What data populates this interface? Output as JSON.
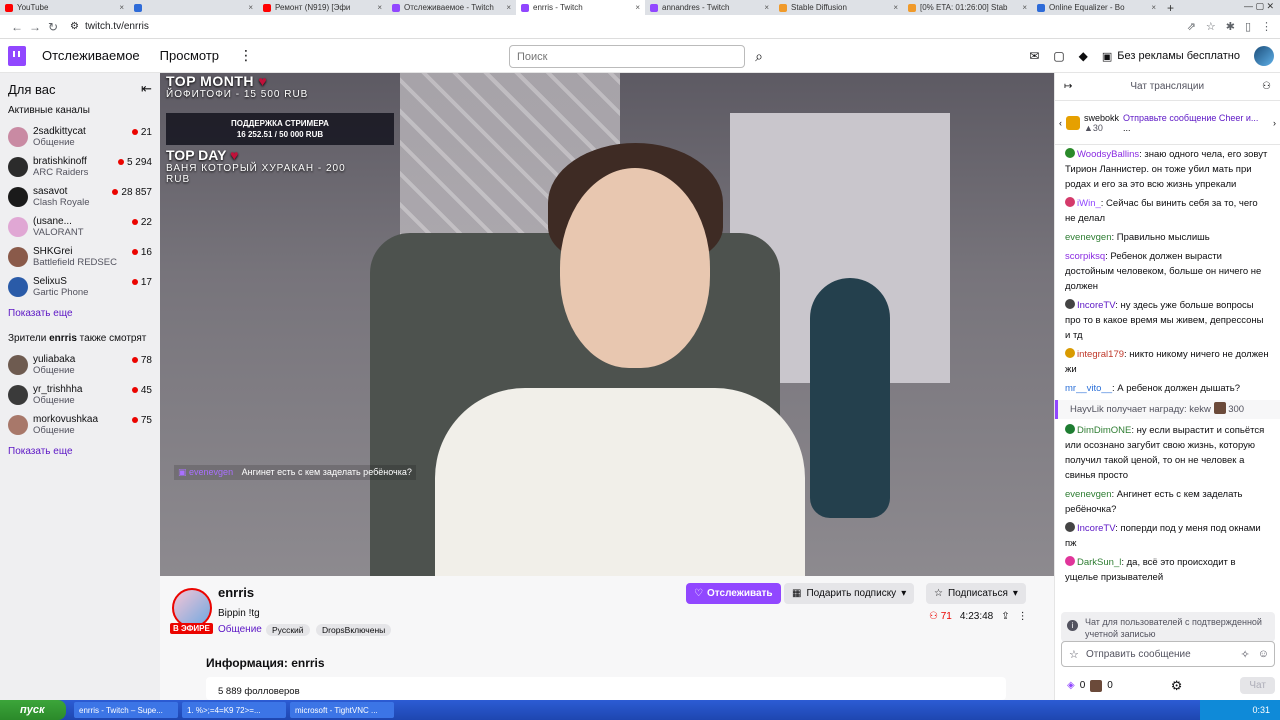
{
  "browser": {
    "tabs": [
      {
        "label": "YouTube",
        "color": "#ff0000"
      },
      {
        "label": "",
        "color": "#2e6bd8"
      },
      {
        "label": "Ремонт (N919) [Эфи",
        "color": "#ff0000"
      },
      {
        "label": "Отслеживаемое - Twitch",
        "color": "#9147ff"
      },
      {
        "label": "enrris - Twitch",
        "color": "#9147ff"
      },
      {
        "label": "annandres - Twitch",
        "color": "#9147ff"
      },
      {
        "label": "Stable Diffusion",
        "color": "#f09a2a"
      },
      {
        "label": "[0% ETA: 01:26:00] Stab",
        "color": "#f09a2a"
      },
      {
        "label": "Online Equalizer - Bo",
        "color": "#2e6bd8"
      }
    ],
    "url": "twitch.tv/enrris"
  },
  "nav": {
    "following": "Отслеживаемое",
    "browse": "Просмотр",
    "search_placeholder": "Поиск",
    "adfree": "Без рекламы бесплатно"
  },
  "sidebar": {
    "title": "Для вас",
    "active_label": "Активные каналы",
    "channels": [
      {
        "name": "2sadkittycat",
        "game": "Общение",
        "viewers": "21",
        "color": "#c98aa3"
      },
      {
        "name": "bratishkinoff",
        "game": "ARC Raiders",
        "viewers": "5 294",
        "color": "#2b2b2b"
      },
      {
        "name": "sasavot",
        "game": "Clash Royale",
        "viewers": "28 857",
        "color": "#1a1a1a"
      },
      {
        "name": "(usane...",
        "game": "VALORANT",
        "viewers": "22",
        "color": "#e0a7d4"
      },
      {
        "name": "SHKGrei",
        "game": "Battlefield REDSEC",
        "viewers": "16",
        "color": "#8a5a4a"
      },
      {
        "name": "SelixuS",
        "game": "Gartic Phone",
        "viewers": "17",
        "color": "#2a5ba8"
      }
    ],
    "show_more": "Показать еще",
    "also_watch_prefix": "Зрители ",
    "also_watch_channel": "enrris",
    "also_watch_suffix": " также смотрят",
    "also": [
      {
        "name": "yuliabaka",
        "game": "Общение",
        "viewers": "78",
        "color": "#6e5b50"
      },
      {
        "name": "yr_trishhha",
        "game": "Общение",
        "viewers": "45",
        "color": "#3a3a3a"
      },
      {
        "name": "morkovushkaa",
        "game": "Общение",
        "viewers": "75",
        "color": "#a8786a"
      }
    ],
    "show_more_2": "Показать еще"
  },
  "video": {
    "top_month": "TOP MONTH",
    "top_month_line": "ЙОФИТОФИ - 15 500 RUB",
    "support_title": "ПОДДЕРЖКА СТРИМЕРА",
    "support_value": "16 252.51 / 50 000 RUB",
    "top_day": "TOP DAY",
    "top_day_line": "ВАНЯ КОТОРЫЙ ХУРАКАН - 200",
    "top_day_line2": "RUB",
    "chat_user": "evenevgen",
    "chat_text": "Ангинет есть с кем заделать ребёночка?"
  },
  "stream": {
    "name": "enrris",
    "live": "В ЭФИРЕ",
    "title": "Bippin !tg",
    "category": "Общение",
    "tags": [
      "Русский",
      "DropsВключены"
    ],
    "follow": "Отслеживать",
    "gift": "Подарить подписку",
    "subscribe": "Подписаться",
    "viewers": "71",
    "uptime": "4:23:48",
    "about": "Информация: enrris",
    "followers": "5 889 фолловеров"
  },
  "chat": {
    "title": "Чат трансляции",
    "cheer_user": "swebokk",
    "cheer_amount": "30",
    "cheer_text": "Отправьте сообщение Cheer и...",
    "cheer_more": "...",
    "messages": [
      {
        "user": "WoodsyBallins",
        "color": "#8a2be2",
        "text": "знаю одного чела, его зовут Тирион Ланнистер. он тоже убил мать при родах и его за это всю жизнь упрекали",
        "badge": "#2a8a2a"
      },
      {
        "user": "iWin_",
        "color": "#9147ff",
        "text": "Сейчас бы винить себя за то, чего не делал",
        "badge": "#d43a6a"
      },
      {
        "user": "evenevgen",
        "color": "#2e7d32",
        "text": "Правильно мыслишь",
        "badge": ""
      },
      {
        "user": "scorpiksq",
        "color": "#8a2be2",
        "text": "Ребенок должен вырасти достойным человеком, больше он ничего не должен",
        "badge": ""
      },
      {
        "user": "IncoreTV",
        "color": "#5c16c5",
        "text": "ну здесь уже больше вопросы про то в какое время мы живем, депрессоны и тд",
        "badge": "#444"
      },
      {
        "user": "integral179",
        "color": "#c0392b",
        "text": "никто никому ничего не должен жи",
        "badge": "#d99a00"
      },
      {
        "user": "mr__vito__",
        "color": "#2a6fd8",
        "text": "А ребенок должен дышать?",
        "badge": ""
      }
    ],
    "reward_user": "HayvLik",
    "reward_text": "получает награду: kekw",
    "reward_cost": "300",
    "messages2": [
      {
        "user": "DimDimONE",
        "color": "#2e7d32",
        "text": "ну если вырастит и сопьётся или осознано загубит свою жизнь, которую получил такой ценой, то он не человек а свинья просто",
        "badge": "#1e7d32"
      },
      {
        "user": "evenevgen",
        "color": "#2e7d32",
        "text": "Ангинет есть с кем заделать ребёночка?",
        "badge": ""
      },
      {
        "user": "IncoreTV",
        "color": "#5c16c5",
        "text": "поперди под у меня под окнами пж",
        "badge": "#444"
      },
      {
        "user": "DarkSun_l",
        "color": "#2e7d32",
        "text": "да, всё это происходит в ущелье призывателей",
        "badge": "#e0359a"
      }
    ],
    "notice": "Чат для пользователей с подтвержденной учетной записью",
    "input_placeholder": "Отправить сообщение",
    "points_a": "0",
    "points_b": "0",
    "send": "Чат"
  },
  "taskbar": {
    "start": "пуск",
    "items": [
      "enrris - Twitch – Supe...",
      "1. %>;=4=K9 72>=...",
      "microsoft - TightVNC ..."
    ],
    "clock": "0:31"
  }
}
